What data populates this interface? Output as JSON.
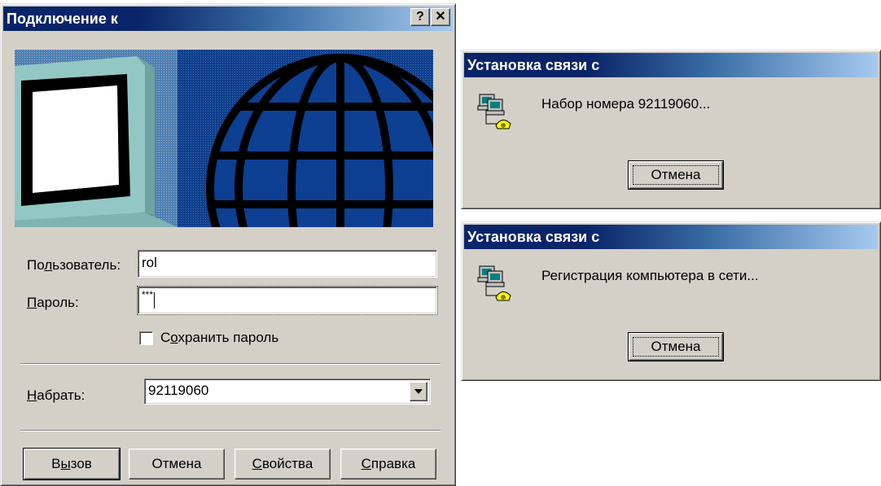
{
  "connect_dialog": {
    "title": "Подключение к",
    "help_button": "?",
    "close_button": "✕",
    "username_label_prefix": "По",
    "username_label_accel": "л",
    "username_label_suffix": "ьзователь:",
    "username_value": "rol",
    "password_label_accel": "П",
    "password_label_suffix": "ароль:",
    "password_value": "***",
    "save_password_prefix": "С",
    "save_password_accel": "о",
    "save_password_suffix": "хранить пароль",
    "save_password_checked": false,
    "dial_label_accel": "Н",
    "dial_label_suffix": "абрать:",
    "dial_value": "92119060",
    "buttons": {
      "call_prefix": "В",
      "call_accel": "ы",
      "call_suffix": "зов",
      "cancel": "Отмена",
      "properties_accel": "С",
      "properties_suffix": "войства",
      "help_accel": "С",
      "help_suffix": "правка"
    }
  },
  "dialing_dialog": {
    "title": "Установка связи с",
    "message": "Набор номера 92119060...",
    "cancel": "Отмена"
  },
  "registering_dialog": {
    "title": "Установка связи с",
    "message": "Регистрация компьютера в сети...",
    "cancel": "Отмена"
  },
  "colors": {
    "title_active": "#0a246a",
    "window_face": "#d4d0c8",
    "banner_blue": "#0a3f8c"
  },
  "icons": [
    "computer-phone-icon",
    "globe-icon",
    "monitor-icon",
    "dropdown-arrow-icon",
    "help-icon",
    "close-icon"
  ]
}
